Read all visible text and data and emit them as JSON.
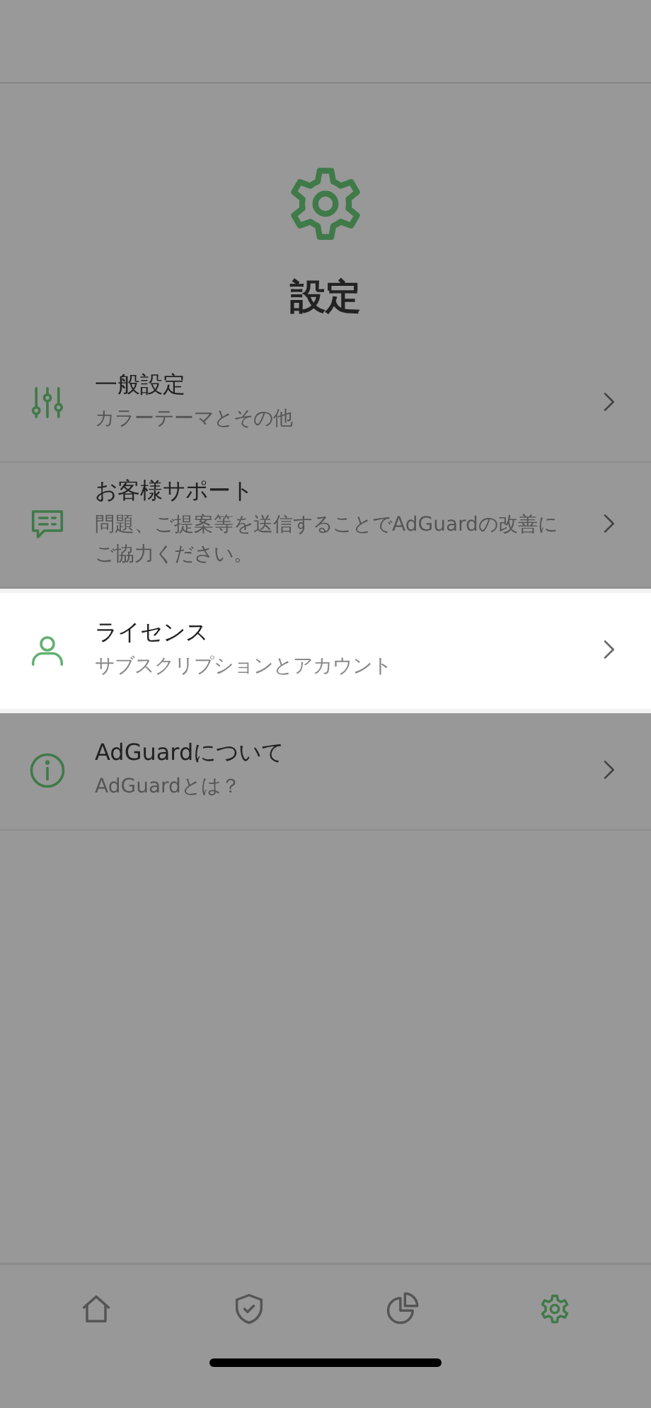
{
  "header": {
    "title": "設定"
  },
  "rows": [
    {
      "title": "一般設定",
      "subtitle": "カラーテーマとその他",
      "highlighted": false
    },
    {
      "title": "お客様サポート",
      "subtitle": "問題、ご提案等を送信することでAdGuardの改善にご協力ください。",
      "highlighted": false
    },
    {
      "title": "ライセンス",
      "subtitle": "サブスクリプションとアカウント",
      "highlighted": true
    },
    {
      "title": "AdGuardについて",
      "subtitle": "AdGuardとは？",
      "highlighted": false
    }
  ],
  "tabs": [
    {
      "selected": false
    },
    {
      "selected": false
    },
    {
      "selected": false
    },
    {
      "selected": true
    }
  ]
}
